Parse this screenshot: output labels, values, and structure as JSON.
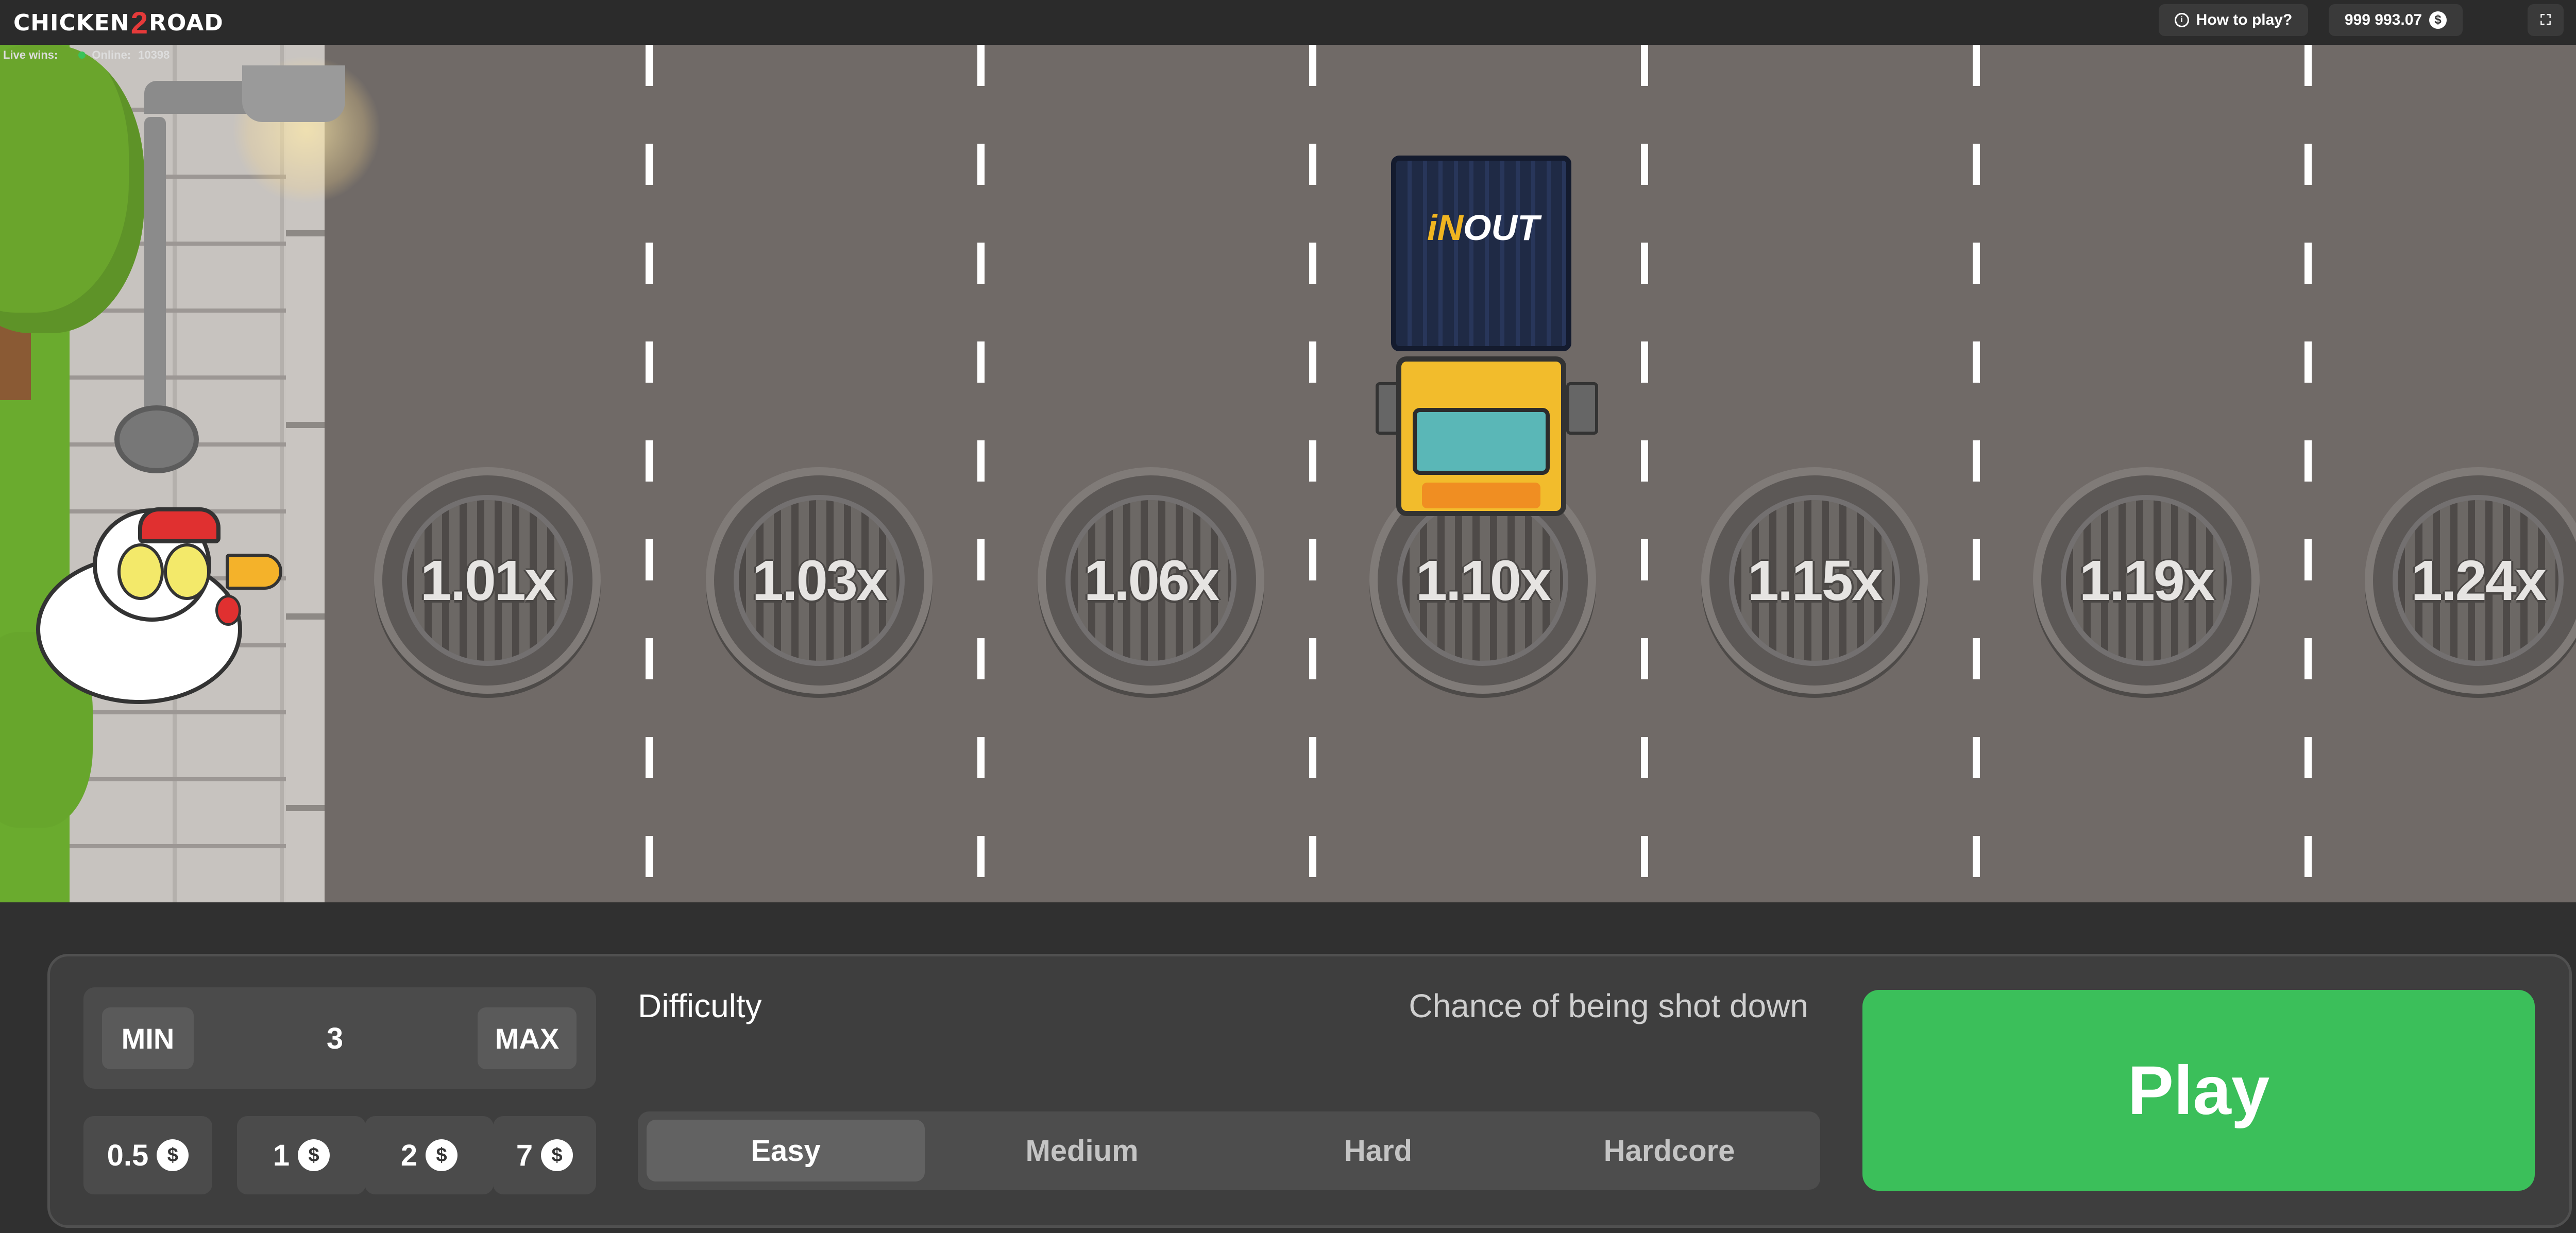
{
  "header": {
    "logo_left": "CHICKEN",
    "logo_num": "2",
    "logo_right": "ROAD",
    "how_to_play": "How to play?",
    "info_icon": "i",
    "balance": "999 993.07",
    "currency_symbol": "$",
    "fullscreen_icon": "⛶",
    "menu_icon": "☰"
  },
  "live": {
    "live_wins": "Live wins:",
    "online_label": "Online:",
    "online_count": "10398"
  },
  "road": {
    "multipliers": [
      "1.01x",
      "1.03x",
      "1.06x",
      "1.10x",
      "1.15x",
      "1.19x",
      "1.24x"
    ],
    "truck_brand_1": "iN",
    "truck_brand_2": "OUT"
  },
  "bet": {
    "min_label": "MIN",
    "max_label": "MAX",
    "value": "3",
    "chips": [
      {
        "amount": "0.5",
        "symbol": "$"
      },
      {
        "amount": "1",
        "symbol": "$"
      },
      {
        "amount": "2",
        "symbol": "$"
      },
      {
        "amount": "7",
        "symbol": "$"
      }
    ]
  },
  "difficulty": {
    "label": "Difficulty",
    "chance_label": "Chance of being shot down",
    "options": [
      "Easy",
      "Medium",
      "Hard",
      "Hardcore"
    ],
    "selected": "Easy"
  },
  "play_label": "Play",
  "colors": {
    "play": "#3bbf5a",
    "road": "#706a67",
    "panel": "#3e3e3e",
    "logo_accent": "#e53a3a"
  }
}
